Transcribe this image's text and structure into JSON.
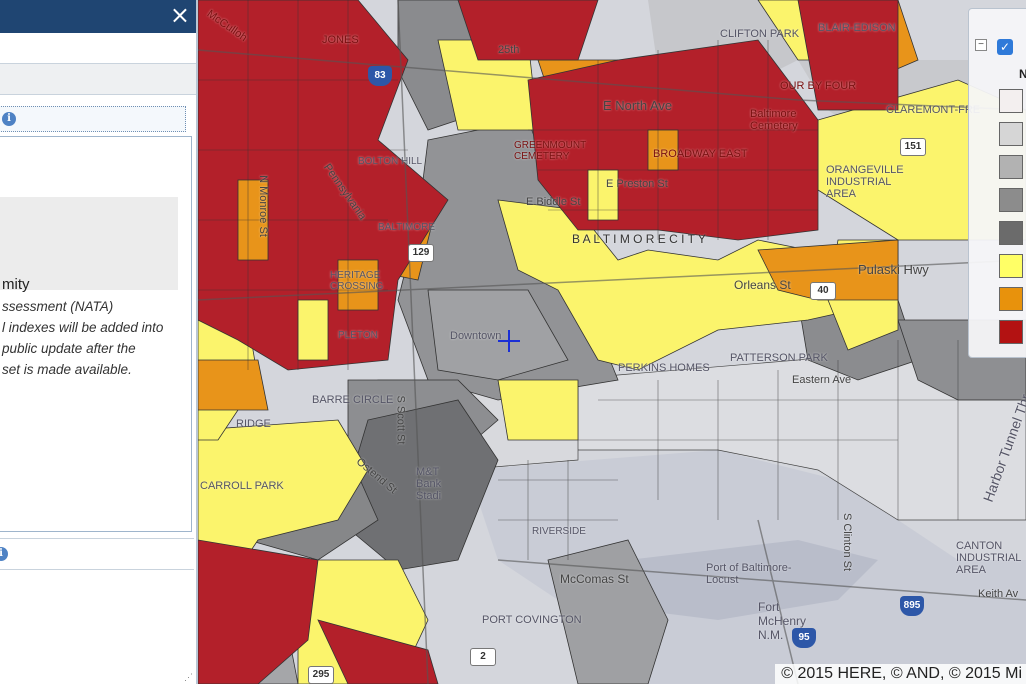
{
  "panel": {
    "close_glyph": "×",
    "info_glyph": "i",
    "layer_title": "mity",
    "description_lines": [
      "ssessment (NATA)",
      "l indexes will be added into",
      "public update after the",
      "set is made available."
    ]
  },
  "map": {
    "attribution": "© 2015 HERE, © AND, © 2015 Mi",
    "labels": {
      "clifton_park": "CLIFTON PARK",
      "mccullough": "McCulloh",
      "jones": "JONES",
      "25th": "25th",
      "e_north_ave": "E North Ave",
      "four_by_four": "OUR BY FOUR",
      "baltimore_cemetery": "Baltimore Cemetery",
      "claremont": "CLAREMONT-FRE",
      "orangeville": "ORANGEVILLE INDUSTRIAL AREA",
      "greenmount": "GREENMOUNT CEMETERY",
      "broadway_east": "BROADWAY EAST",
      "e_preston": "E Preston St",
      "e_biddle": "E Biddle St",
      "baltimore_city": "B A L T I M O R E   C I T Y",
      "pulaski": "Pulaski Hwy",
      "orleans": "Orleans St",
      "downtown": "Downtown",
      "patterson_park": "PATTERSON PARK",
      "perkins_homes": "PERKINS HOMES",
      "eastern_ave": "Eastern Ave",
      "barre_circle": "BARRE CIRCLE",
      "ridge": "RIDGE",
      "carroll_park": "CARROLL PARK",
      "ostend": "Ostend St",
      "mt_bank": "M&T Bank Stadi",
      "port_covington": "PORT COVINGTON",
      "riverside": "RIVERSIDE",
      "port_baltimore": "Port of Baltimore-Locust",
      "fort_mchenry": "Fort McHenry N.M.",
      "mccomas": "McComas St",
      "canton": "CANTON INDUSTRIAL AREA",
      "keith": "Keith Av",
      "harbor_tunnel": "Harbor Tunnel Thr",
      "s_clinton": "S Clinton St",
      "bolton_hill": "BOLTON HILL",
      "mondawmin": "N Monroe St",
      "penn": "Pennsylvania",
      "baltimore_st": "BALTIMORE",
      "sandtown": "HERITAGE CROSSING",
      "pleton": "PLETON",
      "scott_st": "S Scott St",
      "ave": "Ave",
      "st": "St",
      "bair": "BLAIR-EDISON"
    },
    "shields": {
      "i83": "83",
      "i895": "895",
      "i95": "95",
      "r2": "2",
      "r295": "295",
      "r40": "40",
      "r151": "151",
      "r129": "129"
    }
  },
  "legend": {
    "collapse_glyph": "−",
    "check_glyph": "✓",
    "title": "N",
    "swatches": [
      "#f3efef",
      "#d6d6d6",
      "#b2b2b2",
      "#8c8c8c",
      "#6b6b6b",
      "#ffff66",
      "#e8920c",
      "#b31212"
    ]
  },
  "colors": {
    "red": "#b3202a",
    "orange": "#e8941a",
    "yellow": "#fbf46c",
    "dark_gray": "#7d7d7f",
    "mid_gray": "#9a9b9e",
    "light_gray": "#cfd1d6",
    "panel_header": "#1f4572"
  }
}
